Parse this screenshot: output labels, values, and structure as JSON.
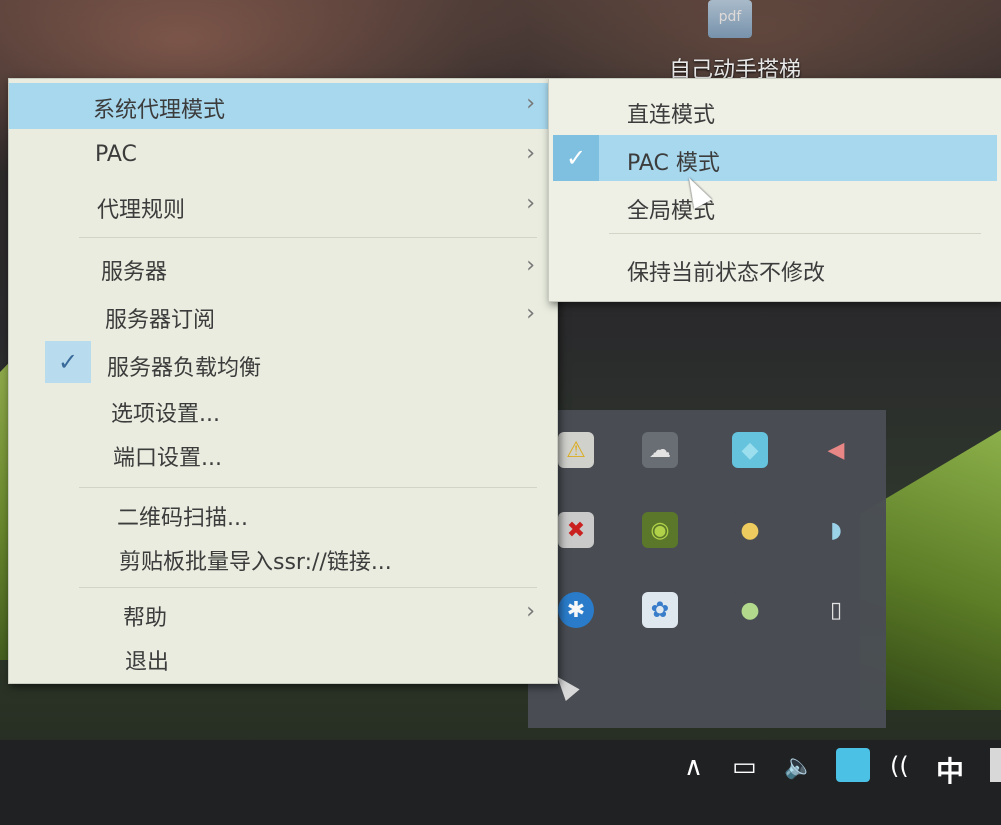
{
  "desktop": {
    "icon_text": "pdf",
    "icon_label": "自己动手搭梯"
  },
  "menu": {
    "items": [
      {
        "label": "系统代理模式",
        "arrow": "›"
      },
      {
        "label": "PAC",
        "arrow": "›"
      },
      {
        "label": "代理规则",
        "arrow": "›"
      },
      {
        "label": "服务器",
        "arrow": "›"
      },
      {
        "label": "服务器订阅",
        "arrow": "›"
      },
      {
        "label": "服务器负载均衡",
        "checked": true
      },
      {
        "label": "选项设置..."
      },
      {
        "label": "端口设置..."
      },
      {
        "label": "二维码扫描..."
      },
      {
        "label": "剪贴板批量导入ssr://链接..."
      },
      {
        "label": "帮助",
        "arrow": "›"
      },
      {
        "label": "退出"
      }
    ],
    "check_glyph": "✓"
  },
  "submenu": {
    "items": [
      {
        "label": "直连模式"
      },
      {
        "label": "PAC 模式",
        "checked": true
      },
      {
        "label": "全局模式"
      },
      {
        "label": "保持当前状态不修改"
      }
    ]
  },
  "tray": {
    "icons": [
      {
        "name": "security-shield-icon",
        "glyph": "⚠"
      },
      {
        "name": "cloud-icon",
        "glyph": "☁"
      },
      {
        "name": "shadowsocks-icon",
        "glyph": "◆"
      },
      {
        "name": "speaker-icon",
        "glyph": "◀"
      },
      {
        "name": "network-error-icon",
        "glyph": "✖"
      },
      {
        "name": "nvidia-icon",
        "glyph": "◉"
      },
      {
        "name": "chat-bubble-icon",
        "glyph": "●"
      },
      {
        "name": "wifi-app-icon",
        "glyph": "◗"
      },
      {
        "name": "bluetooth-icon",
        "glyph": "✱"
      },
      {
        "name": "baidu-cloud-icon",
        "glyph": "✿"
      },
      {
        "name": "wechat-icon",
        "glyph": "●"
      },
      {
        "name": "usb-drive-icon",
        "glyph": "▯"
      }
    ]
  },
  "taskbar": {
    "show_hidden": "∧",
    "battery": "▭",
    "volume": "🔈",
    "wifi": "((",
    "ime": "中"
  }
}
